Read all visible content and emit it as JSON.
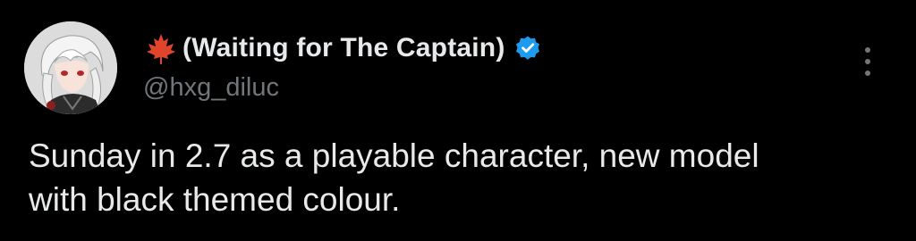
{
  "tweet": {
    "author": {
      "display_name": "(Waiting for The Captain)",
      "handle": "@hxg_diluc",
      "verified": true,
      "name_prefix_icon": "maple-leaf-icon",
      "avatar_icon": "avatar-image"
    },
    "text_line_1": "Sunday in 2.7 as a playable character, new model",
    "text_line_2": "with black themed colour.",
    "menu_icon": "more-options-icon"
  },
  "colors": {
    "background": "#000000",
    "text_primary": "#e7e9ea",
    "text_secondary": "#71767b",
    "verified_badge": "#1d9bf0",
    "leaf": "#e0452c"
  }
}
